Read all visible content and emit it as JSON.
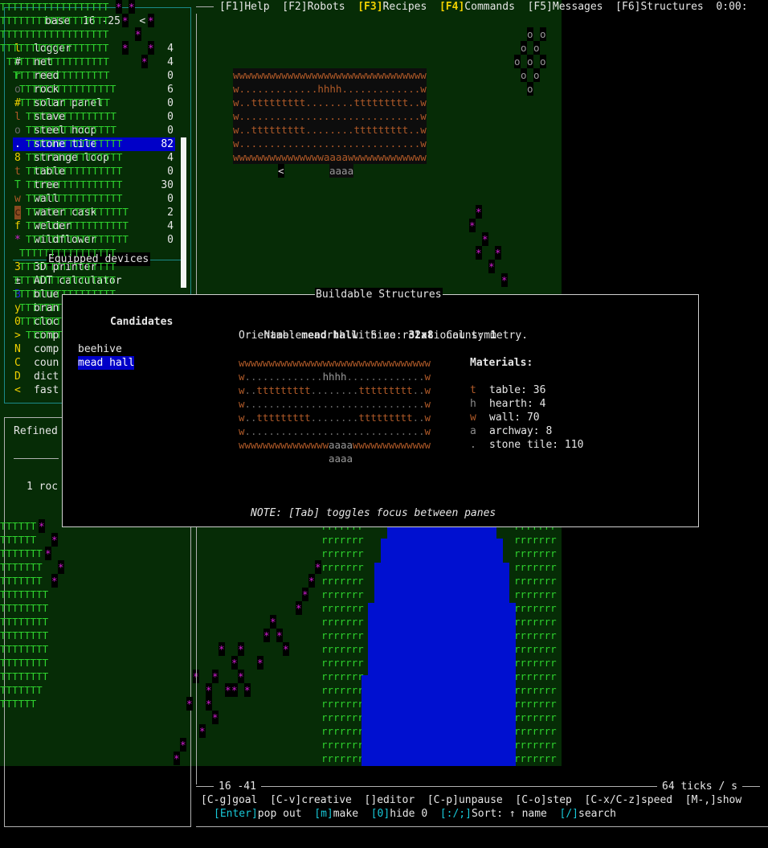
{
  "topbar": {
    "items": [
      {
        "key": "[F1]",
        "label": "Help",
        "hl": false
      },
      {
        "key": "[F2]",
        "label": "Robots",
        "hl": false
      },
      {
        "key": "[F3]",
        "label": "Recipes",
        "hl": true
      },
      {
        "key": "[F4]",
        "label": "Commands",
        "hl": true
      },
      {
        "key": "[F5]",
        "label": "Messages",
        "hl": false
      },
      {
        "key": "[F6]",
        "label": "Structures",
        "hl": false
      }
    ],
    "clock": "0:00:"
  },
  "inventory": {
    "title": "base  16 -25   <",
    "items": [
      {
        "glyph": "l",
        "glyph_color": "#f0d000",
        "name": "logger",
        "count": "4"
      },
      {
        "glyph": "#",
        "glyph_color": "#e6e6e6",
        "name": "net",
        "count": "4"
      },
      {
        "glyph": "r",
        "glyph_color": "#2ed12e",
        "name": "reed",
        "count": "0"
      },
      {
        "glyph": "o",
        "glyph_color": "#6a6a6a",
        "name": "rock",
        "count": "6"
      },
      {
        "glyph": "#",
        "glyph_color": "#f0d000",
        "name": "solar panel",
        "count": "0"
      },
      {
        "glyph": "l",
        "glyph_color": "#b05a28",
        "name": "stave",
        "count": "0"
      },
      {
        "glyph": "o",
        "glyph_color": "#6a6a6a",
        "name": "steel hoop",
        "count": "0"
      },
      {
        "glyph": ".",
        "glyph_color": "#e6e6e6",
        "name": "stone tile",
        "count": "82"
      },
      {
        "glyph": "8",
        "glyph_color": "#f0d000",
        "name": "strange loop",
        "count": "4"
      },
      {
        "glyph": "t",
        "glyph_color": "#b05a28",
        "name": "table",
        "count": "0"
      },
      {
        "glyph": "T",
        "glyph_color": "#2ed12e",
        "name": "tree",
        "count": "30"
      },
      {
        "glyph": "w",
        "glyph_color": "#b05a28",
        "name": "wall",
        "count": "0"
      },
      {
        "glyph": "c",
        "glyph_color": "#f0d000",
        "name": "water cask",
        "count": "2"
      },
      {
        "glyph": "f",
        "glyph_color": "#f0d000",
        "name": "welder",
        "count": "4"
      },
      {
        "glyph": "*",
        "glyph_color": "#d020d0",
        "name": "wildflower",
        "count": "0"
      }
    ],
    "equipped_label": "Equipped devices",
    "equipped": [
      {
        "glyph": "3",
        "glyph_color": "#f0d000",
        "name": "3D printer"
      },
      {
        "glyph": "±",
        "glyph_color": "#e6e6e6",
        "name": "ADT calculator"
      },
      {
        "glyph": "B",
        "glyph_color": "#2020e0",
        "name": "blue"
      },
      {
        "glyph": "y",
        "glyph_color": "#f0d000",
        "name": "bran"
      },
      {
        "glyph": "0",
        "glyph_color": "#f0d000",
        "name": "cloc"
      },
      {
        "glyph": ">",
        "glyph_color": "#f0d000",
        "name": "comp"
      },
      {
        "glyph": "N",
        "glyph_color": "#f0d000",
        "name": "comp"
      },
      {
        "glyph": "C",
        "glyph_color": "#f0d000",
        "name": "coun"
      },
      {
        "glyph": "D",
        "glyph_color": "#f0d000",
        "name": "dict"
      },
      {
        "glyph": "<",
        "glyph_color": "#f0d000",
        "name": "fast"
      }
    ]
  },
  "refined": {
    "title": "Refined",
    "line": "1 roc"
  },
  "modal": {
    "title": "Buildable Structures",
    "candidates_label": "Candidates",
    "candidates": [
      "beehive",
      "mead hall"
    ],
    "selected_candidate": "mead hall",
    "name_label": "Name:",
    "name_value": "mead hall",
    "size_label": "Size:",
    "size_value": "32x8",
    "count_label": "Count:",
    "count_value": "1",
    "orientable_line": "Orientable: north with no rotational symmetry.",
    "preview": [
      "wwwwwwwwwwwwwwwwwwwwwwwwwwwwwwww",
      "w.............hhhh.............w",
      "w..ttttttttt........ttttttttt..w",
      "w..............................w",
      "w..ttttttttt........ttttttttt..w",
      "w..............................w",
      "wwwwwwwwwwwwwwwaaaawwwwwwwwwwwww",
      "               aaaa"
    ],
    "materials_label": "Materials:",
    "materials": [
      {
        "glyph": "t",
        "label": "table: 36"
      },
      {
        "glyph": "h",
        "label": "hearth: 4"
      },
      {
        "glyph": "w",
        "label": "wall: 70"
      },
      {
        "glyph": "a",
        "label": "archway: 8"
      },
      {
        "glyph": ".",
        "label": "stone tile: 110"
      }
    ],
    "note": "NOTE: [Tab] toggles focus between panes"
  },
  "status": {
    "coords": "16 -41",
    "speed": "64 ticks / s"
  },
  "keybar1": [
    {
      "key": "[C-g]",
      "label": "goal"
    },
    {
      "key": "[C-v]",
      "label": "creative"
    },
    {
      "key": "[]",
      "label": "editor"
    },
    {
      "key": "[C-p]",
      "label": "unpause"
    },
    {
      "key": "[C-o]",
      "label": "step"
    },
    {
      "key": "[C-x/C-z]",
      "label": "speed"
    },
    {
      "key": "[M-,]",
      "label": "show"
    }
  ],
  "keybar2": [
    {
      "key": "[Enter]",
      "label": "pop out"
    },
    {
      "key": "[m]",
      "label": "make"
    },
    {
      "key": "[0]",
      "label": "hide 0"
    },
    {
      "key": "[:/;]",
      "label": "Sort: ↑ name"
    },
    {
      "key": "[/]",
      "label": "search"
    }
  ],
  "colors": {
    "grass": "#062c06",
    "water": "#0010d0",
    "tree": "#2ed12e",
    "flower": "#d020d0",
    "wall": "#b05a28",
    "highlight": "#f0d000",
    "selection": "#0000c8"
  }
}
